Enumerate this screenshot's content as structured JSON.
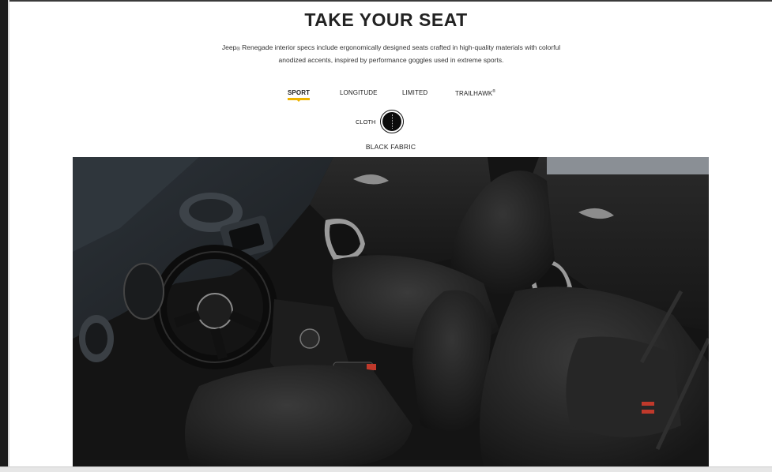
{
  "section": {
    "title": "TAKE YOUR SEAT",
    "description_brand": "Jeep",
    "description_mark": "®",
    "description_rest": " Renegade interior specs include ergonomically designed seats crafted in high-quality materials with colorful anodized accents, inspired by performance goggles used in extreme sports."
  },
  "trims": {
    "items": [
      {
        "label": "SPORT",
        "active": true
      },
      {
        "label": "LONGITUDE",
        "active": false
      },
      {
        "label": "LIMITED",
        "active": false
      },
      {
        "label": "TRAILHAWK",
        "active": false
      }
    ],
    "trailhawk_mark": "®"
  },
  "material": {
    "type_label": "CLOTH",
    "selected_name": "BLACK FABRIC",
    "swatch_color": "#0c0c0c"
  },
  "colors": {
    "accent": "#f0b400",
    "text": "#222222"
  }
}
